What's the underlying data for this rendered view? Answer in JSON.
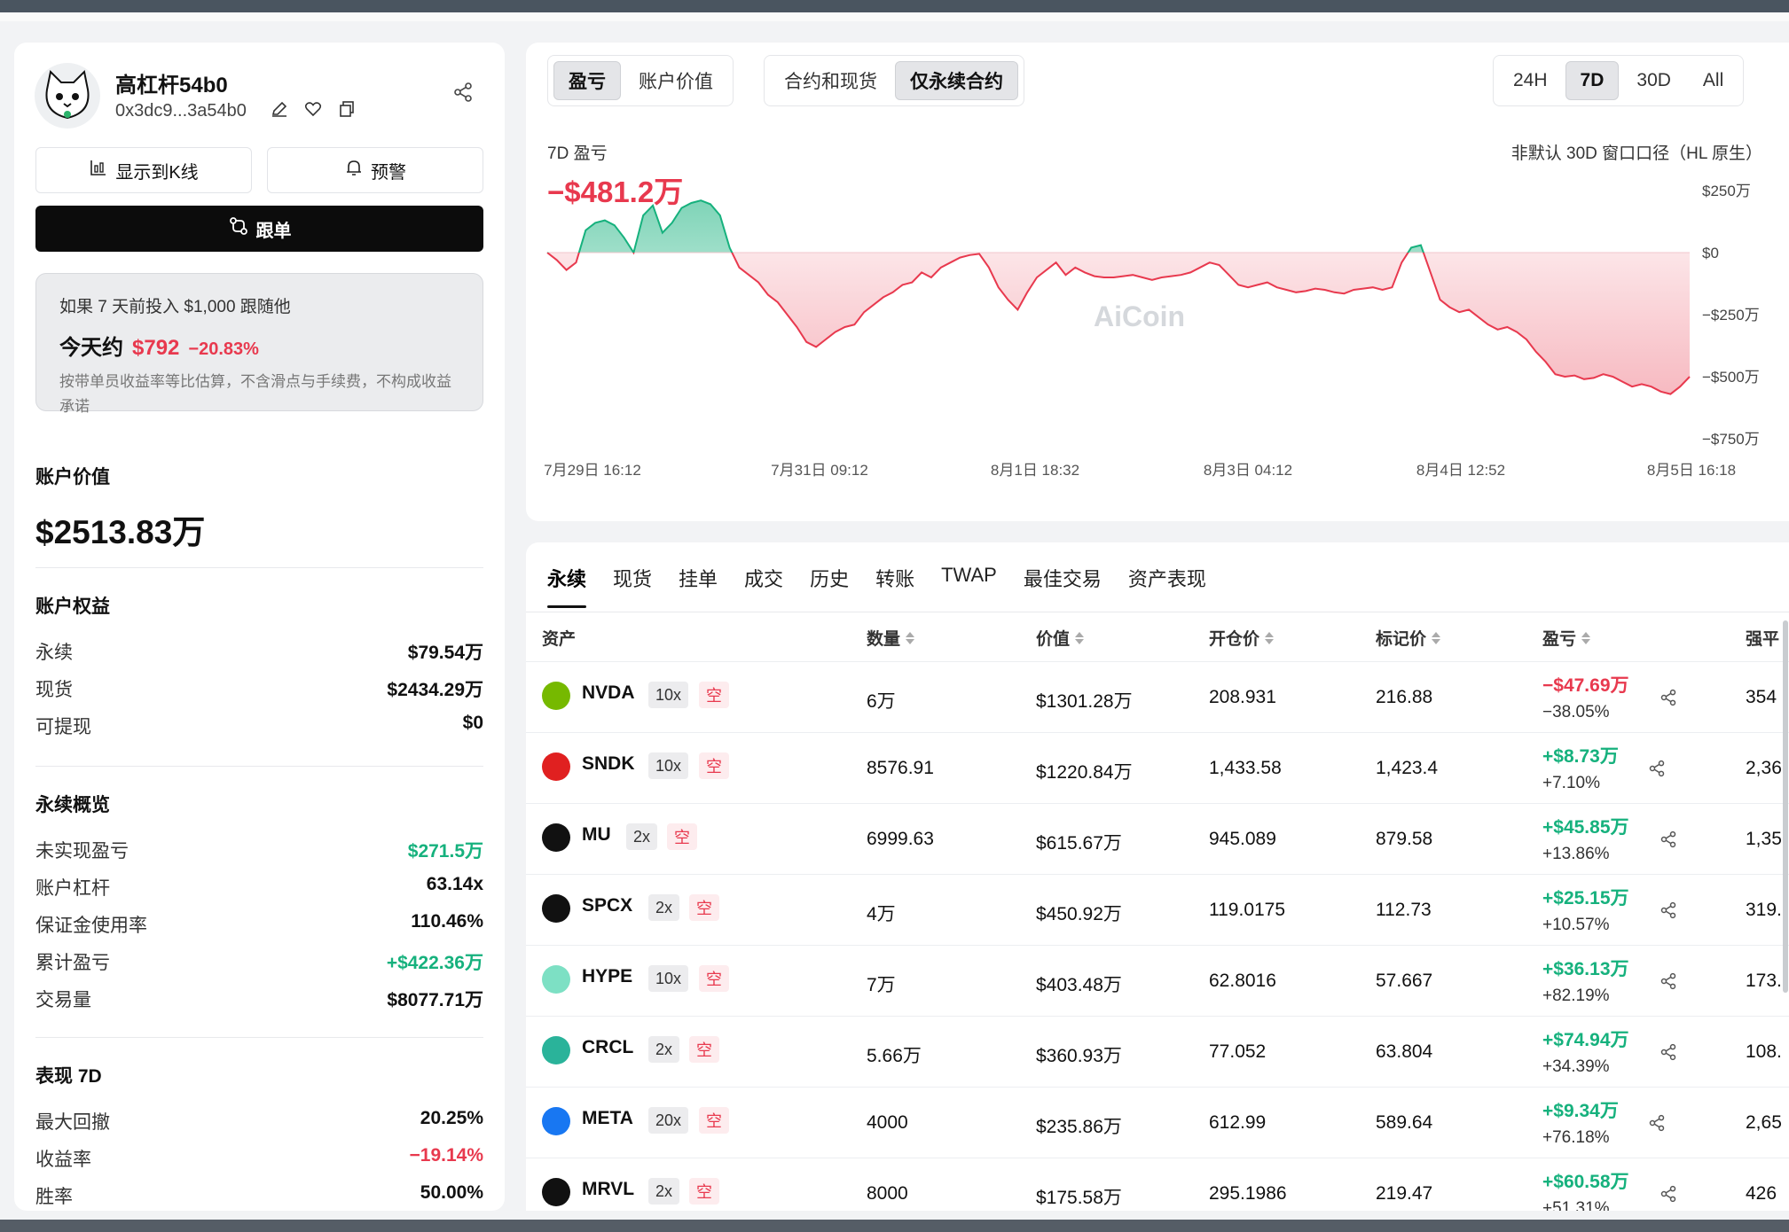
{
  "profile": {
    "name": "高杠杆54b0",
    "address": "0x3dc9...3a54b0",
    "show_kline_label": "显示到K线",
    "alert_label": "预警",
    "follow_label": "跟单"
  },
  "simulation": {
    "question": "如果 7 天前投入 $1,000 跟随他",
    "today_label": "今天约",
    "today_value": "$792",
    "today_pct": "−20.83%",
    "note": "按带单员收益率等比估算，不含滑点与手续费，不构成收益承诺"
  },
  "account_value": {
    "title": "账户价值",
    "value": "$2513.83万"
  },
  "equity": {
    "title": "账户权益",
    "items": [
      {
        "label": "永续",
        "value": "$79.54万"
      },
      {
        "label": "现货",
        "value": "$2434.29万"
      },
      {
        "label": "可提现",
        "value": "$0"
      }
    ]
  },
  "perp_overview": {
    "title": "永续概览",
    "items": [
      {
        "label": "未实现盈亏",
        "value": "$271.5万"
      },
      {
        "label": "账户杠杆",
        "value": "63.14x"
      },
      {
        "label": "保证金使用率",
        "value": "110.46%"
      },
      {
        "label": "累计盈亏",
        "value": "+$422.36万"
      },
      {
        "label": "交易量",
        "value": "$8077.71万"
      }
    ]
  },
  "performance": {
    "title": "表现 7D",
    "items": [
      {
        "label": "最大回撤",
        "value": "20.25%"
      },
      {
        "label": "收益率",
        "value": "−19.14%"
      },
      {
        "label": "胜率",
        "value": "50.00%"
      }
    ]
  },
  "chart_controls": {
    "metric_tabs": [
      "盈亏",
      "账户价值"
    ],
    "scope_tabs": [
      "合约和现货",
      "仅永续合约"
    ],
    "range_tabs": [
      "24H",
      "7D",
      "30D",
      "All"
    ],
    "label": "7D 盈亏",
    "value": "−$481.2万",
    "note": "非默认 30D 窗口口径（HL 原生）",
    "watermark": "AiCoin"
  },
  "chart_data": {
    "type": "area",
    "title": "7D 盈亏",
    "ylabel": "",
    "y_ticks": [
      "$250万",
      "$0",
      "−$250万",
      "−$500万",
      "−$750万"
    ],
    "y_tick_values": [
      250,
      0,
      -250,
      -500,
      -750
    ],
    "x_ticks": [
      "7月29日 16:12",
      "7月31日 09:12",
      "8月1日 18:32",
      "8月3日 04:12",
      "8月4日 12:52",
      "8月5日 16:18"
    ],
    "ylim": [
      -750,
      250
    ],
    "unit": "万 USD",
    "values": [
      0,
      -30,
      -70,
      -40,
      90,
      120,
      130,
      110,
      60,
      0,
      150,
      190,
      80,
      120,
      180,
      200,
      210,
      195,
      150,
      20,
      -60,
      -90,
      -120,
      -170,
      -200,
      -250,
      -300,
      -360,
      -380,
      -350,
      -320,
      -300,
      -290,
      -240,
      -210,
      -180,
      -160,
      -130,
      -120,
      -80,
      -100,
      -60,
      -40,
      -20,
      -10,
      -5,
      -60,
      -140,
      -190,
      -230,
      -160,
      -100,
      -70,
      -40,
      -90,
      -60,
      -80,
      -95,
      -100,
      -100,
      -95,
      -90,
      -100,
      -110,
      -100,
      -95,
      -90,
      -80,
      -60,
      -40,
      -50,
      -90,
      -130,
      -140,
      -130,
      -120,
      -140,
      -150,
      -160,
      -155,
      -145,
      -150,
      -160,
      -165,
      -150,
      -145,
      -140,
      -150,
      -140,
      -40,
      20,
      30,
      -80,
      -190,
      -220,
      -240,
      -230,
      -260,
      -290,
      -310,
      -300,
      -320,
      -350,
      -400,
      -440,
      -490,
      -500,
      -495,
      -510,
      -505,
      -490,
      -500,
      -520,
      -540,
      -530,
      -540,
      -560,
      -570,
      -540,
      -500
    ]
  },
  "positions": {
    "tabs": [
      "永续",
      "现货",
      "挂单",
      "成交",
      "历史",
      "转账",
      "TWAP",
      "最佳交易",
      "资产表现"
    ],
    "headers": [
      "资产",
      "数量",
      "价值",
      "开仓价",
      "标记价",
      "盈亏",
      "强平"
    ],
    "rows": [
      {
        "symbol": "NVDA",
        "leverage": "10x",
        "side": "空",
        "qty": "6万",
        "value": "$1301.28万",
        "entry": "208.931",
        "mark": "216.88",
        "pnl": "−$47.69万",
        "pnl_pct": "−38.05%",
        "liq": "354",
        "icon_color": "#76b900",
        "pnl_positive": false
      },
      {
        "symbol": "SNDK",
        "leverage": "10x",
        "side": "空",
        "qty": "8576.91",
        "value": "$1220.84万",
        "entry": "1,433.58",
        "mark": "1,423.4",
        "pnl": "+$8.73万",
        "pnl_pct": "+7.10%",
        "liq": "2,36",
        "icon_color": "#e02020",
        "pnl_positive": true
      },
      {
        "symbol": "MU",
        "leverage": "2x",
        "side": "空",
        "qty": "6999.63",
        "value": "$615.67万",
        "entry": "945.089",
        "mark": "879.58",
        "pnl": "+$45.85万",
        "pnl_pct": "+13.86%",
        "liq": "1,35",
        "icon_color": "#111111",
        "pnl_positive": true
      },
      {
        "symbol": "SPCX",
        "leverage": "2x",
        "side": "空",
        "qty": "4万",
        "value": "$450.92万",
        "entry": "119.0175",
        "mark": "112.73",
        "pnl": "+$25.15万",
        "pnl_pct": "+10.57%",
        "liq": "319.",
        "icon_color": "#111111",
        "pnl_positive": true
      },
      {
        "symbol": "HYPE",
        "leverage": "10x",
        "side": "空",
        "qty": "7万",
        "value": "$403.48万",
        "entry": "62.8016",
        "mark": "57.667",
        "pnl": "+$36.13万",
        "pnl_pct": "+82.19%",
        "liq": "173.",
        "icon_color": "#7de0c4",
        "pnl_positive": true
      },
      {
        "symbol": "CRCL",
        "leverage": "2x",
        "side": "空",
        "qty": "5.66万",
        "value": "$360.93万",
        "entry": "77.052",
        "mark": "63.804",
        "pnl": "+$74.94万",
        "pnl_pct": "+34.39%",
        "liq": "108.",
        "icon_color": "#2ab39a",
        "pnl_positive": true
      },
      {
        "symbol": "META",
        "leverage": "20x",
        "side": "空",
        "qty": "4000",
        "value": "$235.86万",
        "entry": "612.99",
        "mark": "589.64",
        "pnl": "+$9.34万",
        "pnl_pct": "+76.18%",
        "liq": "2,65",
        "icon_color": "#1877f2",
        "pnl_positive": true
      },
      {
        "symbol": "MRVL",
        "leverage": "2x",
        "side": "空",
        "qty": "8000",
        "value": "$175.58万",
        "entry": "295.1986",
        "mark": "219.47",
        "pnl": "+$60.58万",
        "pnl_pct": "+51.31%",
        "liq": "426",
        "icon_color": "#111111",
        "pnl_positive": true
      }
    ]
  },
  "colors": {
    "green": "#16b17d",
    "red": "#e8394e",
    "accent": "#0c0c0c"
  }
}
